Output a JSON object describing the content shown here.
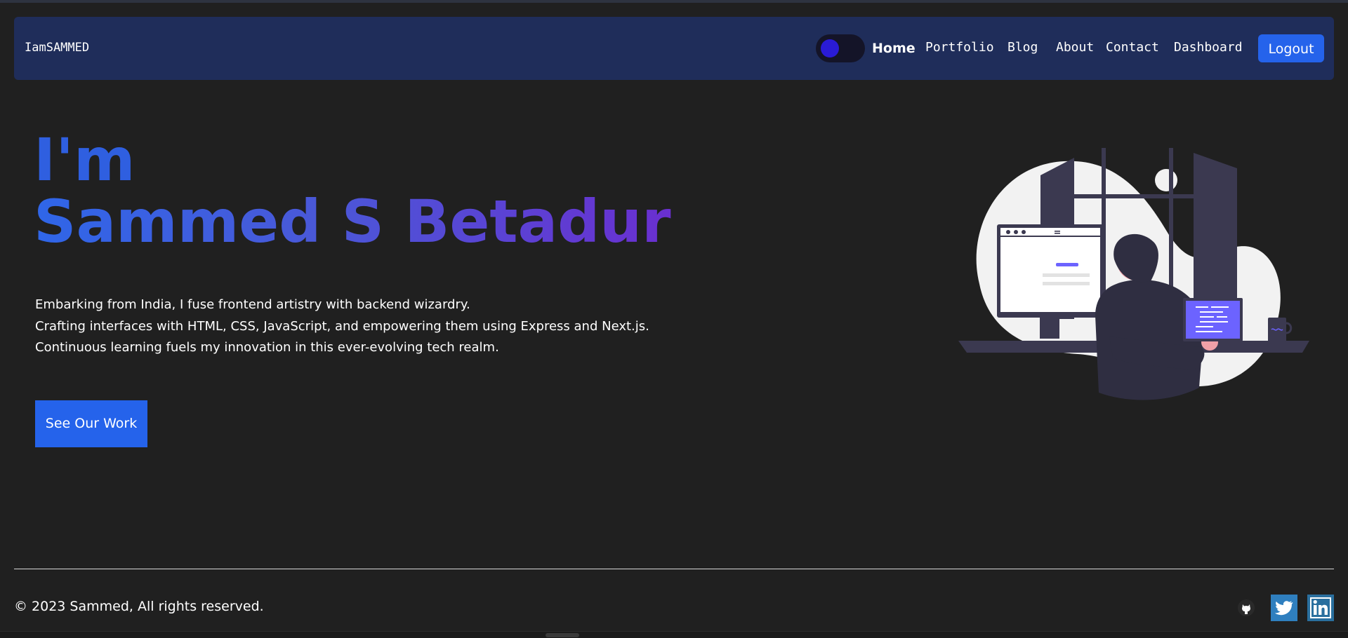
{
  "brand": "IamSAMMED",
  "nav": {
    "links": [
      "Home",
      "Portfolio",
      "Blog",
      "About",
      "Contact",
      "Dashboard"
    ],
    "logout_label": "Logout"
  },
  "hero": {
    "greeting": "I'm",
    "name": "Sammed S Betadur",
    "description": [
      "Embarking from India, I fuse frontend artistry with backend wizardry.",
      "Crafting interfaces with HTML, CSS, JavaScript, and empowering them using Express and Next.js.",
      "Continuous learning fuels my innovation in this ever-evolving tech realm."
    ],
    "cta_label": "See Our Work"
  },
  "footer": {
    "copyright": "© 2023 Sammed, All rights reserved.",
    "social_icons": [
      "github-icon",
      "twitter-icon",
      "linkedin-icon"
    ]
  },
  "colors": {
    "background": "#202020",
    "navbar": "#1f2d5a",
    "accent": "#2563eb",
    "gradient_start": "#2f66e8",
    "gradient_end": "#6a2fd0"
  }
}
